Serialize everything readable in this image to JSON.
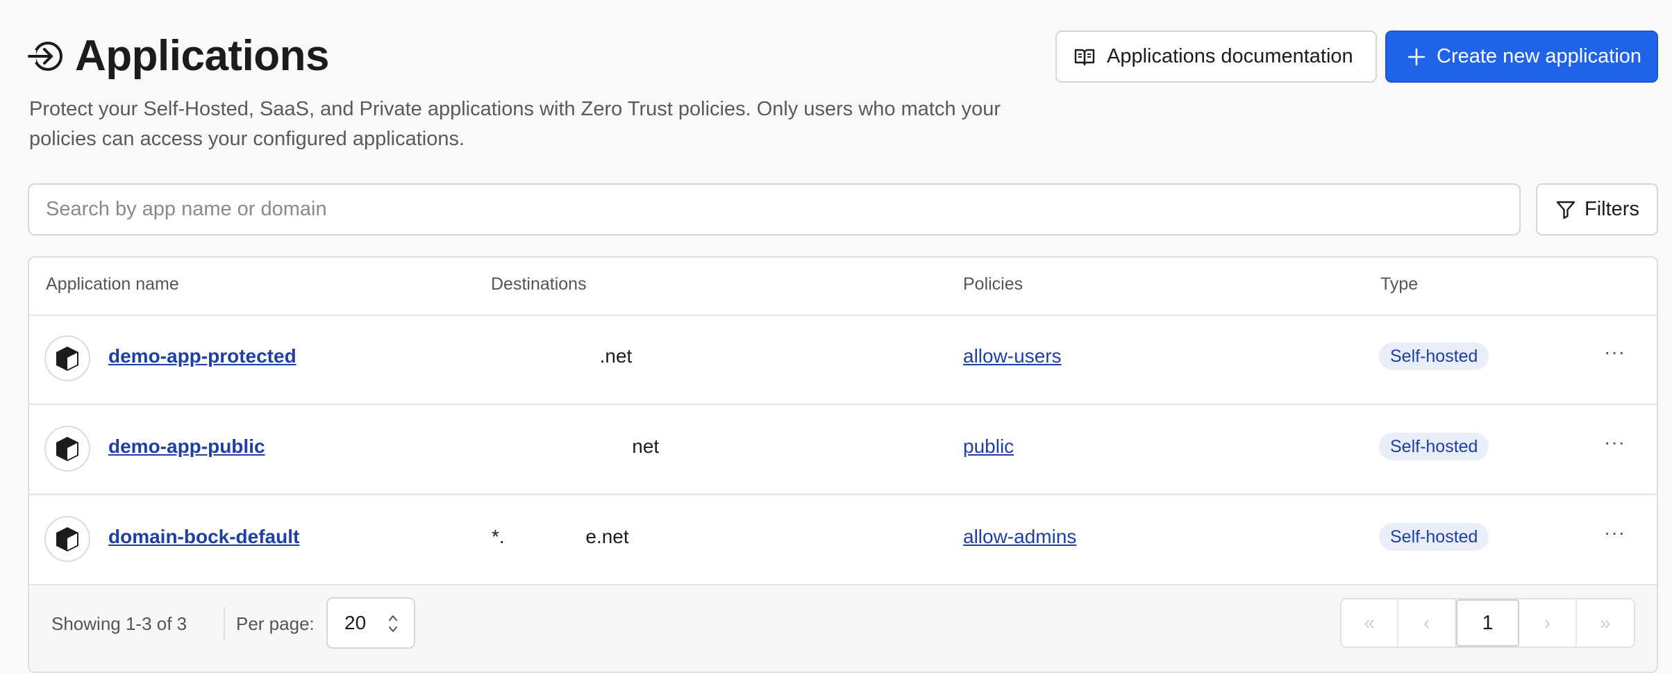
{
  "header": {
    "title": "Applications",
    "title_icon": "sign-in-arrow-icon",
    "description": "Protect your Self-Hosted, SaaS, and Private applications with Zero Trust policies. Only users who match your policies can access your configured applications."
  },
  "actions": {
    "docs_label": "Applications documentation",
    "docs_icon": "book-icon",
    "create_label": "Create new application",
    "create_icon": "plus-icon"
  },
  "search": {
    "placeholder": "Search by app name or domain",
    "value": ""
  },
  "filters": {
    "label": "Filters",
    "icon": "funnel-icon"
  },
  "table": {
    "columns": [
      "Application name",
      "Destinations",
      "Policies",
      "Type"
    ],
    "rows": [
      {
        "name": "demo-app-protected",
        "destination": "                    .net",
        "policy": "allow-users",
        "type": "Self-hosted",
        "icon": "cube-icon"
      },
      {
        "name": "demo-app-public",
        "destination": "                          net",
        "policy": "public",
        "type": "Self-hosted",
        "icon": "cube-icon"
      },
      {
        "name": "domain-bock-default",
        "destination": "*.               e.net",
        "policy": "allow-admins",
        "type": "Self-hosted",
        "icon": "cube-icon"
      }
    ],
    "row_menu": "···"
  },
  "footer": {
    "showing": "Showing 1-3 of 3",
    "per_page_label": "Per page:",
    "per_page_value": "20",
    "pagination": {
      "first": "«",
      "prev": "‹",
      "current": "1",
      "next": "›",
      "last": "»"
    }
  },
  "colors": {
    "primary": "#1f64e8",
    "link": "#1d3fa6",
    "badge_bg": "#e9eef9"
  }
}
